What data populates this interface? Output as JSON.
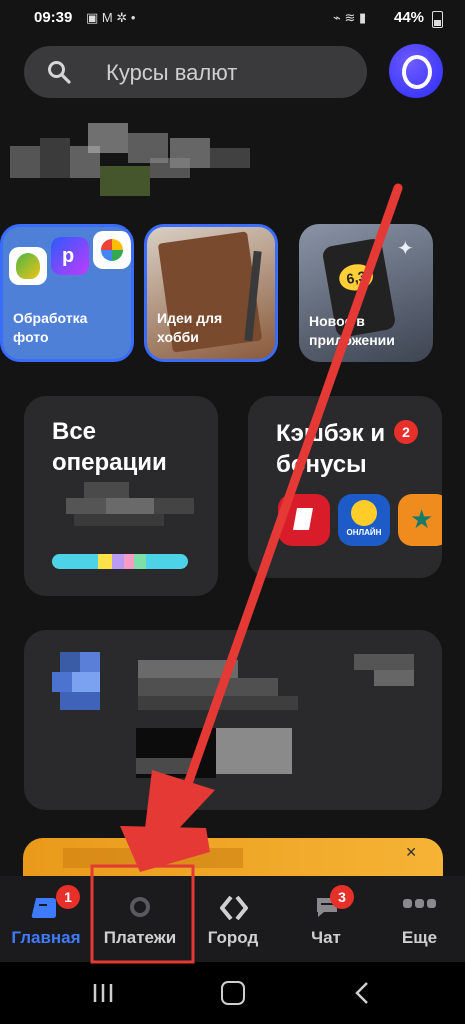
{
  "status_bar": {
    "time": "09:39",
    "icons": "▣ M ✲ •",
    "signal": "⌁ ≋ ▮",
    "battery": "44%"
  },
  "search": {
    "placeholder": "Курсы валют"
  },
  "avatar": {
    "letter": "О"
  },
  "stories": [
    {
      "label": "Обработка фото"
    },
    {
      "label": "Идеи для хобби"
    },
    {
      "label": "Новое в приложении"
    }
  ],
  "operations_card": {
    "title": "Все операции"
  },
  "cashback_card": {
    "title": "Кэшбэк и бонусы",
    "badge": "2",
    "online_label": "ОНЛАЙН"
  },
  "bottom_nav": [
    {
      "label": "Главная",
      "badge": "1",
      "active": true
    },
    {
      "label": "Платежи"
    },
    {
      "label": "Город"
    },
    {
      "label": "Чат",
      "badge": "3"
    },
    {
      "label": "Еще"
    }
  ],
  "colors": {
    "accent": "#3f7bff",
    "badge": "#e8302a",
    "arrow": "#e53935"
  }
}
